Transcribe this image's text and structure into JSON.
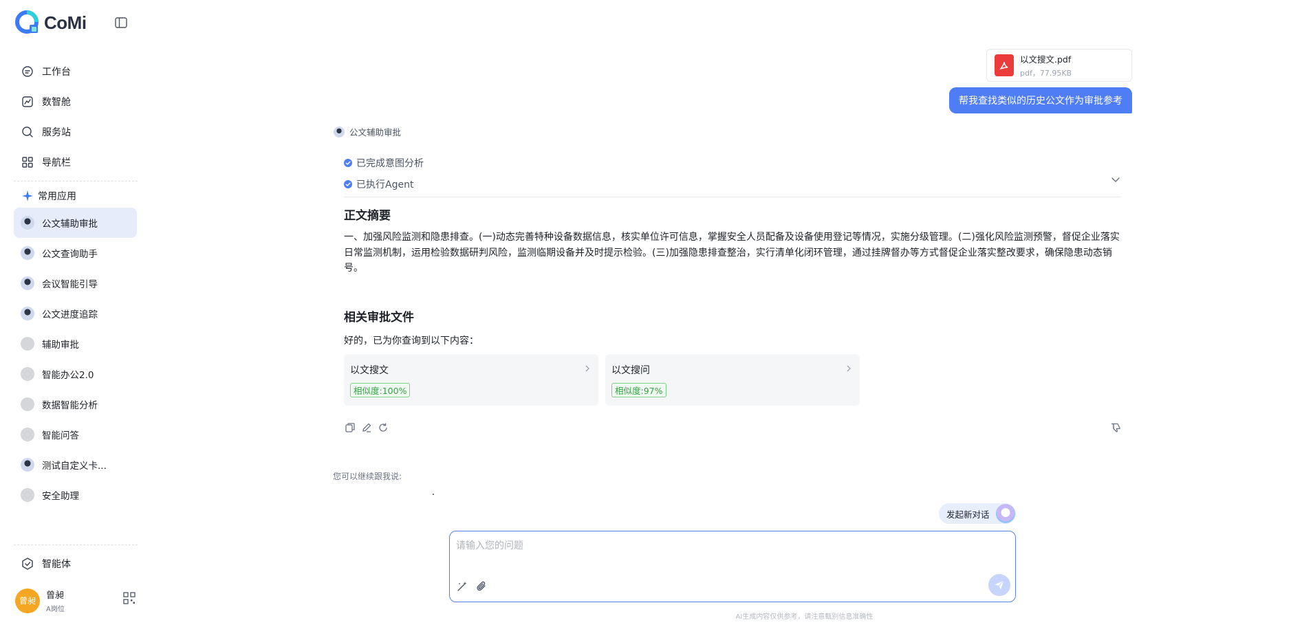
{
  "brand": {
    "name": "CoMi",
    "accent": "#4f7df6"
  },
  "nav": [
    {
      "label": "工作台",
      "icon": "workbench-icon"
    },
    {
      "label": "数智舱",
      "icon": "chart-icon"
    },
    {
      "label": "服务站",
      "icon": "search-icon"
    },
    {
      "label": "导航栏",
      "icon": "grid-icon"
    }
  ],
  "common_apps": {
    "title": "常用应用",
    "items": [
      {
        "label": "公文辅助审批",
        "avatar": "photo",
        "active": true
      },
      {
        "label": "公文查询助手",
        "avatar": "photo"
      },
      {
        "label": "会议智能引导",
        "avatar": "photo"
      },
      {
        "label": "公文进度追踪",
        "avatar": "photo"
      },
      {
        "label": "辅助审批",
        "avatar": "grey"
      },
      {
        "label": "智能办公2.0",
        "avatar": "grey"
      },
      {
        "label": "数据智能分析",
        "avatar": "grey"
      },
      {
        "label": "智能问答",
        "avatar": "grey"
      },
      {
        "label": "测试自定义卡...",
        "avatar": "photo"
      },
      {
        "label": "安全助理",
        "avatar": "grey"
      }
    ]
  },
  "agent_entry": {
    "label": "智能体"
  },
  "user": {
    "avatar_text": "曾昶",
    "name": "曾昶",
    "role": "A岗位"
  },
  "attachment": {
    "name": "以文搜文.pdf",
    "meta": "pdf，77.95KB"
  },
  "user_message": "帮我查找类似的历史公文作为审批参考",
  "bot": {
    "name": "公文辅助审批",
    "steps": [
      "已完成意图分析",
      "已执行Agent"
    ],
    "summary_title": "正文摘要",
    "summary_text": "一、加强风险监测和隐患排查。(一)动态完善特种设备数据信息，核实单位许可信息，掌握安全人员配备及设备使用登记等情况，实施分级管理。(二)强化风险监测预警，督促企业落实日常监测机制，运用检验数据研判风险，监测临期设备并及时提示检验。(三)加强隐患排查整治，实行清单化闭环管理，通过挂牌督办等方式督促企业落实整改要求，确保隐患动态销号。",
    "related_title": "相关审批文件",
    "related_intro": "好的，已为你查询到以下内容：",
    "related": [
      {
        "title": "以文搜文",
        "similarity": "相似度:100%"
      },
      {
        "title": "以文搜问",
        "similarity": "相似度:97%"
      }
    ]
  },
  "follow_up": "您可以继续跟我说:",
  "new_chat": "发起新对话",
  "input": {
    "placeholder": "请输入您的问题",
    "value": ""
  },
  "disclaimer": "AI生成内容仅供参考，请注意甄别信息准确性"
}
